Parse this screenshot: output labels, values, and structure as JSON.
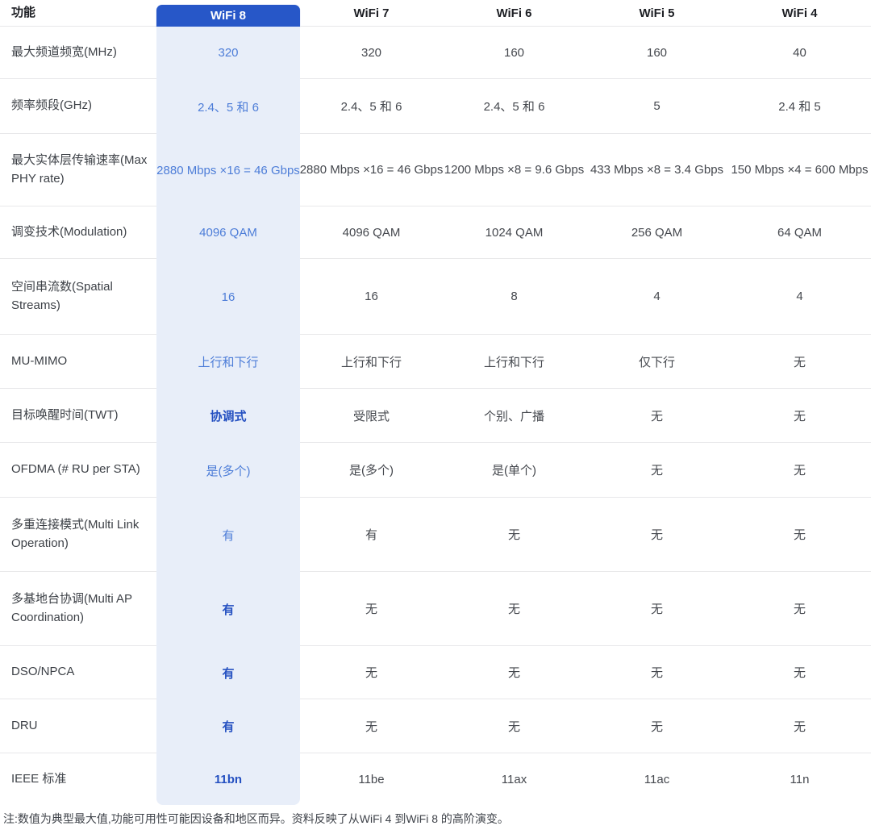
{
  "header": {
    "feature_label": "功能",
    "columns": [
      "WiFi 8",
      "WiFi 7",
      "WiFi 6",
      "WiFi 5",
      "WiFi 4"
    ]
  },
  "rows": [
    {
      "label": "最大频道频宽(MHz)",
      "values": [
        "320",
        "320",
        "160",
        "160",
        "40"
      ],
      "wifi8_style": "light"
    },
    {
      "label": "频率频段(GHz)",
      "values": [
        "2.4、5 和 6",
        "2.4、5 和 6",
        "2.4、5 和 6",
        "5",
        "2.4 和 5"
      ],
      "wifi8_style": "light"
    },
    {
      "label": "最大实体层传输速率(Max PHY rate)",
      "values": [
        "2880 Mbps ×16 = 46 Gbps",
        "2880 Mbps ×16 = 46 Gbps",
        "1200 Mbps ×8 = 9.6 Gbps",
        "433 Mbps ×8 = 3.4 Gbps",
        "150 Mbps ×4 = 600 Mbps"
      ],
      "wifi8_style": "light"
    },
    {
      "label": "调变技术(Modulation)",
      "values": [
        "4096 QAM",
        "4096 QAM",
        "1024 QAM",
        "256 QAM",
        "64 QAM"
      ],
      "wifi8_style": "light"
    },
    {
      "label": "空间串流数(Spatial Streams)",
      "values": [
        "16",
        "16",
        "8",
        "4",
        "4"
      ],
      "wifi8_style": "light"
    },
    {
      "label": "MU-MIMO",
      "values": [
        "上行和下行",
        "上行和下行",
        "上行和下行",
        "仅下行",
        "无"
      ],
      "wifi8_style": "light"
    },
    {
      "label": "目标唤醒时间(TWT)",
      "values": [
        "协调式",
        "受限式",
        "个别、广播",
        "无",
        "无"
      ],
      "wifi8_style": "bold"
    },
    {
      "label": "OFDMA (# RU per STA)",
      "values": [
        "是(多个)",
        "是(多个)",
        "是(单个)",
        "无",
        "无"
      ],
      "wifi8_style": "light"
    },
    {
      "label": "多重连接模式(Multi Link Operation)",
      "values": [
        "有",
        "有",
        "无",
        "无",
        "无"
      ],
      "wifi8_style": "light"
    },
    {
      "label": "多基地台协调(Multi AP Coordination)",
      "values": [
        "有",
        "无",
        "无",
        "无",
        "无"
      ],
      "wifi8_style": "bold"
    },
    {
      "label": "DSO/NPCA",
      "values": [
        "有",
        "无",
        "无",
        "无",
        "无"
      ],
      "wifi8_style": "bold"
    },
    {
      "label": "DRU",
      "values": [
        "有",
        "无",
        "无",
        "无",
        "无"
      ],
      "wifi8_style": "bold"
    },
    {
      "label": "IEEE 标准",
      "values": [
        "11bn",
        "11be",
        "11ax",
        "11ac",
        "11n"
      ],
      "wifi8_style": "bold"
    }
  ],
  "note": "注:数值为典型最大值,功能可用性可能因设备和地区而异。资料反映了从WiFi 4 到WiFi 8 的高阶演变。",
  "colors": {
    "accent": "#2757c8",
    "highlight_column_bg": "#e8eef9",
    "value_blue": "#4d7dd8",
    "value_blue_bold": "#2450c1"
  }
}
